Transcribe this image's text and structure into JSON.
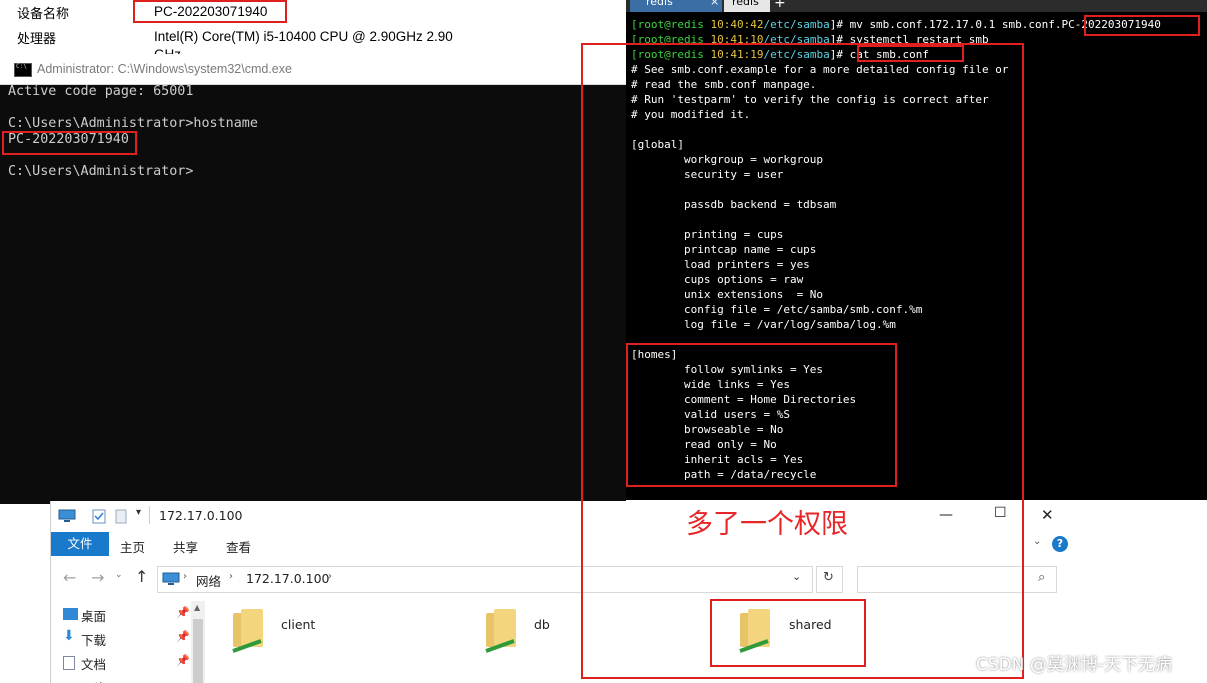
{
  "sysinfo": {
    "device_name_label": "设备名称",
    "device_name_value": "PC-202203071940",
    "processor_label": "处理器",
    "processor_value": "Intel(R) Core(TM) i5-10400 CPU @ 2.90GHz   2.90",
    "processor_value_cont": "GHz"
  },
  "cmd": {
    "title": "Administrator: C:\\Windows\\system32\\cmd.exe",
    "lines": [
      "Active code page: 65001",
      "",
      "C:\\Users\\Administrator>hostname",
      "PC-202203071940",
      "",
      "C:\\Users\\Administrator>"
    ]
  },
  "terminal": {
    "tab_label": "redis",
    "tab_close": "×",
    "tab2_label": "redis",
    "new_tab": "+",
    "cmd1_prefix": "[root@redis ",
    "cmd1_time": "10:40:42",
    "cmd1_path": "/etc/samba",
    "cmd1_suffix": "]# mv smb.conf.172.17.0.1 smb.conf.",
    "cmd1_host": "PC-202203071940",
    "cmd2_prefix": "[root@redis ",
    "cmd2_time": "10:41:10",
    "cmd2_path": "/etc/samba",
    "cmd2_suffix": "]# systemctl restart smb",
    "cmd3_prefix": "[root@redis ",
    "cmd3_time": "10:41:19",
    "cmd3_path": "/etc/samba",
    "cmd3_suffix": "]# cat smb.conf",
    "config_lines": [
      "# See smb.conf.example for a more detailed config file or",
      "# read the smb.conf manpage.",
      "# Run 'testparm' to verify the config is correct after",
      "# you modified it.",
      "",
      "[global]",
      "        workgroup = workgroup",
      "        security = user",
      "",
      "        passdb backend = tdbsam",
      "",
      "        printing = cups",
      "        printcap name = cups",
      "        load printers = yes",
      "        cups options = raw",
      "        unix extensions  = No",
      "        config file = /etc/samba/smb.conf.%m",
      "        log file = /var/log/samba/log.%m",
      "",
      "[homes]",
      "        follow symlinks = Yes",
      "        wide links = Yes",
      "        comment = Home Directories",
      "        valid users = %S",
      "        browseable = No",
      "        read only = No",
      "        inherit acls = Yes",
      "        path = /data/recycle"
    ]
  },
  "explorer": {
    "title": "172.17.0.100",
    "ribbon_tabs": [
      "文件",
      "主页",
      "共享",
      "查看"
    ],
    "address_network": "网络",
    "address_host": "172.17.0.100",
    "sidebar": [
      "桌面",
      "下载",
      "文档",
      "图片"
    ],
    "folders": [
      "client",
      "db",
      "shared"
    ],
    "minimize": "—",
    "maximize": "☐",
    "close": "✕"
  },
  "annotation": "多了一个权限",
  "watermark": "CSDN @莫渊博-天下无病",
  "colors": {
    "annotation_red": "#e0201f",
    "ribbon_blue": "#1979ca",
    "prompt_green": "#3cd43c",
    "time_yellow": "#e3c33e",
    "path_cyan": "#5ad4e6"
  }
}
